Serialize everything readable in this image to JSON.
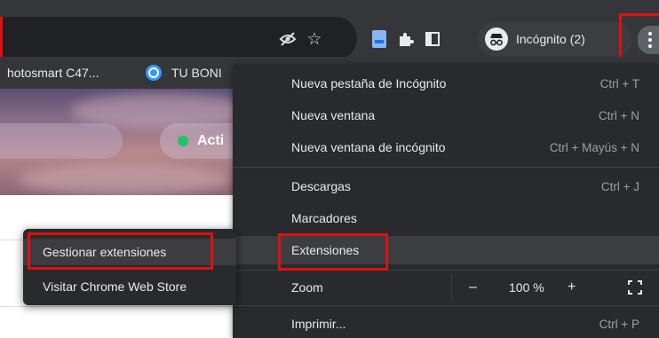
{
  "toolbar": {
    "icons": [
      "eye-off-icon",
      "star-icon",
      "extension-doc-icon",
      "puzzle-icon",
      "side-panel-icon",
      "incognito-icon",
      "kebab-menu-icon"
    ],
    "incognito_label": "Incógnito (2)"
  },
  "bookmarks": {
    "items": [
      {
        "label": "hotosmart C47..."
      },
      {
        "label": "TU BONI"
      }
    ]
  },
  "page": {
    "status_label": "Acti"
  },
  "menu": {
    "items": [
      {
        "label": "Nueva pestaña de Incógnito",
        "shortcut": "Ctrl + T"
      },
      {
        "label": "Nueva ventana",
        "shortcut": "Ctrl + N"
      },
      {
        "label": "Nueva ventana de incógnito",
        "shortcut": "Ctrl + Mayús + N"
      },
      {
        "label": "Descargas",
        "shortcut": "Ctrl + J"
      },
      {
        "label": "Marcadores",
        "shortcut": ""
      },
      {
        "label": "Extensiones",
        "shortcut": ""
      },
      {
        "label": "Zoom",
        "shortcut": ""
      },
      {
        "label": "Imprimir...",
        "shortcut": "Ctrl + P"
      }
    ],
    "zoom": {
      "minus": "–",
      "value": "100 %",
      "plus": "+"
    }
  },
  "submenu": {
    "items": [
      {
        "label": "Gestionar extensiones"
      },
      {
        "label": "Visitar Chrome Web Store"
      }
    ]
  },
  "colors": {
    "annotation_red": "#e01010",
    "menu_bg": "#292a2d",
    "toolbar_bg": "#35363a"
  }
}
